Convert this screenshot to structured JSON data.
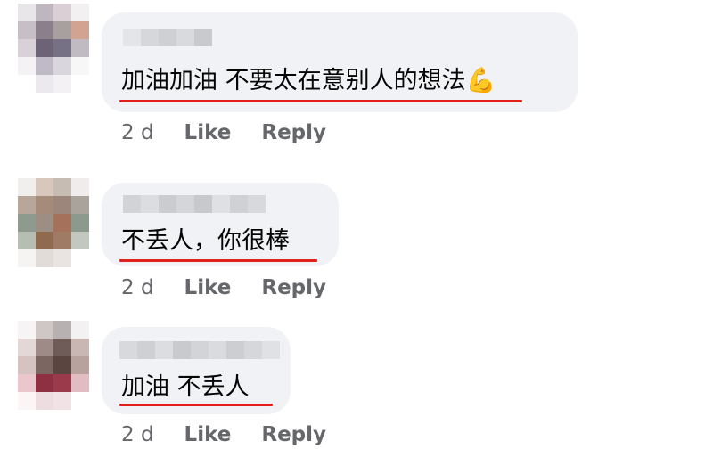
{
  "comments": [
    {
      "text": "加油加油 不要太在意别人的想法",
      "emoji": "💪",
      "time": "2 d",
      "like_label": "Like",
      "reply_label": "Reply",
      "avatar_colors": [
        "#e9e6ea",
        "#bfb7c0",
        "#d9cfd4",
        "#f3f0f2",
        "#c6bfc6",
        "#8b7f8c",
        "#a89f9f",
        "#d3a392",
        "#d8d2d8",
        "#6d6376",
        "#777186",
        "#c0bac2",
        "#f4f2f4",
        "#bfbac6",
        "#d9d6de",
        "#f8f7f8",
        "#ffffff",
        "#ece9ee",
        "#f3f1f4",
        "#ffffff"
      ],
      "name_blur_colors": [
        "#e4e5e8",
        "#d6d7db",
        "#cfd0d4",
        "#d9dadd",
        "#c9cace"
      ]
    },
    {
      "text": "不丢人，你很棒",
      "emoji": "",
      "time": "2 d",
      "like_label": "Like",
      "reply_label": "Reply",
      "avatar_colors": [
        "#f1efed",
        "#d8c7bd",
        "#c6bcb3",
        "#efeceb",
        "#b7a79a",
        "#a58b79",
        "#9c857a",
        "#a9a39c",
        "#8e9a8d",
        "#9d8e83",
        "#a5715a",
        "#8c9a8e",
        "#b6bdb3",
        "#8f6a4f",
        "#9f7b65",
        "#c2c7c0",
        "#f5f4f3",
        "#e2dcd8",
        "#e9e4e1",
        "#ffffff"
      ],
      "name_blur_colors": [
        "#d2d3d6",
        "#dcdde0",
        "#cbccd0",
        "#d5d6d9",
        "#c8c9cc",
        "#dfe0e3",
        "#d0d1d5",
        "#d8d9dc"
      ]
    },
    {
      "text": "加油 不丢人",
      "emoji": "",
      "time": "2 d",
      "like_label": "Like",
      "reply_label": "Reply",
      "avatar_colors": [
        "#f6f4f4",
        "#cfc6c6",
        "#b8b1b1",
        "#f3f1f1",
        "#e4d8d6",
        "#9e8a86",
        "#6f5b57",
        "#c9b7b3",
        "#d4c3c0",
        "#7b6662",
        "#5a4541",
        "#b8a29d",
        "#e9c7cd",
        "#8e2f42",
        "#9b3a4b",
        "#e1bcc3",
        "#fbf5f6",
        "#eeddE0",
        "#f1e2e5",
        "#ffffff"
      ],
      "name_blur_colors": [
        "#d8d9dc",
        "#cfd0d4",
        "#dcdde0",
        "#c9cace",
        "#d3d4d8",
        "#dadbde",
        "#cdced2",
        "#d6d7da",
        "#e0e1e4"
      ]
    }
  ]
}
